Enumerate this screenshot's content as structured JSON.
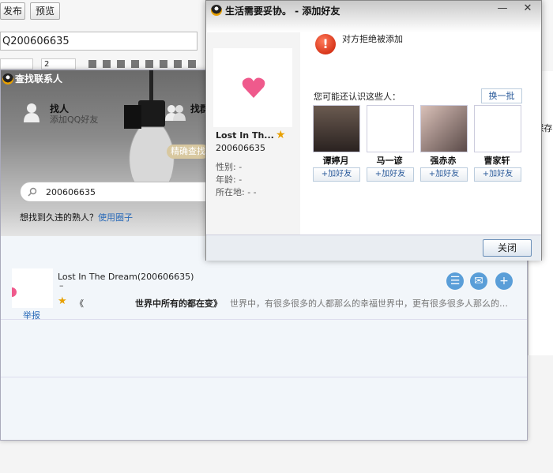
{
  "editor": {
    "publish": "发布",
    "preview": "预览",
    "title_value": "Q200606635",
    "font_size_value": "2",
    "right_fragment": "t保存"
  },
  "find_window": {
    "title": "查找联系人",
    "tab_people": "找人",
    "tab_people_sub": "添加QQ好友",
    "tab_group": "找群",
    "precise_search": "精确查找",
    "search_value": "200606635",
    "hint_text": "想找到久违的熟人？",
    "hint_link": "使用圈子",
    "result": {
      "name_line": "Lost In The Dream(200606635)",
      "dash": "–",
      "report": "举报",
      "quote_open": "《",
      "title": "世界中所有的都在变》",
      "desc": "世界中，有很多很多的人都那么的幸福世界中，更有很多很多人那么的…"
    }
  },
  "add_window": {
    "title": "生活需要妥协。 - 添加好友",
    "minimize": "—",
    "close": "✕",
    "message": "对方拒绝被添加",
    "profile": {
      "name": "Lost In Th...",
      "qq": "200606635",
      "gender_label": "性别:",
      "gender_value": "-",
      "age_label": "年龄:",
      "age_value": "-",
      "location_label": "所在地:",
      "location_value": "-    -"
    },
    "suggest_label": "您可能还认识这些人：",
    "change_batch": "换一批",
    "candidates": [
      {
        "name": "谭婷月",
        "add": "+加好友"
      },
      {
        "name": "马一谚",
        "add": "+加好友"
      },
      {
        "name": "强赤赤",
        "add": "+加好友"
      },
      {
        "name": "曹家轩",
        "add": "+加好友"
      }
    ],
    "close_button": "关闭"
  },
  "colors": {
    "accent": "#5a9ed8",
    "link": "#2a6ab8",
    "heart": "#ef5a8c"
  }
}
